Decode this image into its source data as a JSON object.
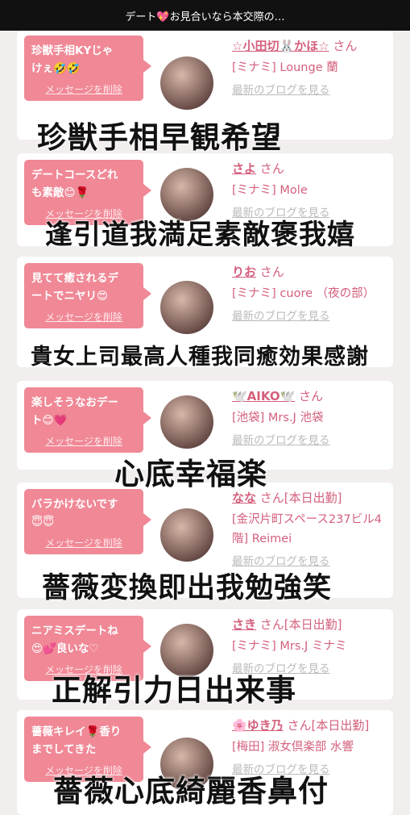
{
  "header": {
    "title": "デート💖お見合いなら本交際の…"
  },
  "bubble_delete_label": "メッセージを削除",
  "blog_label": "最新のブログを見る",
  "cards": [
    {
      "message": "珍獣手相KYじゃ\nけぇ🤣🤣",
      "name": "☆小田切🐰かほ☆",
      "suffix": "さん",
      "shop": "[ミナミ] Lounge 蘭",
      "overlay": "珍獣手相早観希望"
    },
    {
      "message": "デートコースどれ\nも素敵😊🌹",
      "name": "さよ",
      "suffix": "さん",
      "shop": "[ミナミ] Mole",
      "overlay": "逢引道我満足素敵褒我嬉"
    },
    {
      "message": "見てて癒されるデ\nートでニヤリ😍",
      "name": "りお",
      "suffix": "さん",
      "shop": "[ミナミ] cuore （夜の部）",
      "overlay": "貴女上司最高人種我同癒効果感謝"
    },
    {
      "message": "楽しそうなおデー\nト😊💗",
      "name": "🕊️AIKO🕊️",
      "suffix": "さん",
      "shop": "[池袋] Mrs.J 池袋",
      "overlay": "心底幸福楽"
    },
    {
      "message": "バラかけないです\n😇😇",
      "name": "なな",
      "suffix": "さん[本日出勤]",
      "shop": "[金沢片町スペース237ビル4階] Reimei",
      "overlay": "薔薇変換即出我勉強笑"
    },
    {
      "message": "ニアミスデートね\n😍💕良いな♡",
      "name": "さき",
      "suffix": "さん[本日出勤]",
      "shop": "[ミナミ] Mrs.J ミナミ",
      "overlay": "正解引力日出来事"
    },
    {
      "message": "薔薇キレイ🌹香り\nまでしてきた",
      "name": "🌸ゆき乃",
      "suffix": "さん[本日出勤]",
      "shop": "[梅田] 淑女倶楽部 水響",
      "overlay": "薔薇心底綺麗香鼻付"
    }
  ]
}
